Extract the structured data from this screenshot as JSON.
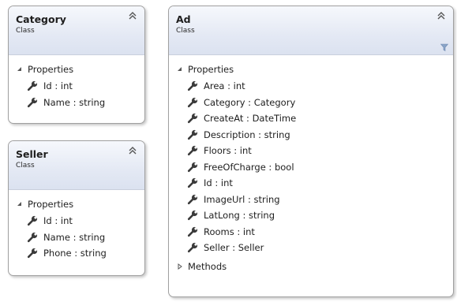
{
  "diagram": {
    "classes": [
      {
        "id": "category",
        "name": "Category",
        "kind": "Class",
        "collapse_icon": "double-chevron-up-icon",
        "sections": [
          {
            "label": "Properties",
            "expanded": true,
            "members": [
              "Id : int",
              "Name : string"
            ]
          }
        ]
      },
      {
        "id": "seller",
        "name": "Seller",
        "kind": "Class",
        "collapse_icon": "double-chevron-up-icon",
        "sections": [
          {
            "label": "Properties",
            "expanded": true,
            "members": [
              "Id : int",
              "Name : string",
              "Phone : string"
            ]
          }
        ]
      },
      {
        "id": "ad",
        "name": "Ad",
        "kind": "Class",
        "collapse_icon": "double-chevron-up-icon",
        "filter_icon": "filter-funnel-icon",
        "sections": [
          {
            "label": "Properties",
            "expanded": true,
            "members": [
              "Area : int",
              "Category : Category",
              "CreateAt : DateTime",
              "Description : string",
              "Floors : int",
              "FreeOfCharge : bool",
              "Id : int",
              "ImageUrl : string",
              "LatLong : string",
              "Rooms : int",
              "Seller : Seller"
            ]
          },
          {
            "label": "Methods",
            "expanded": false,
            "members": []
          }
        ]
      }
    ],
    "colors": {
      "header_top": "#f6f8fc",
      "header_bottom": "#dbe2f0",
      "border": "#a0a0a0",
      "wrench": "#3a3a3a",
      "filter": "#8aa4c8"
    }
  }
}
